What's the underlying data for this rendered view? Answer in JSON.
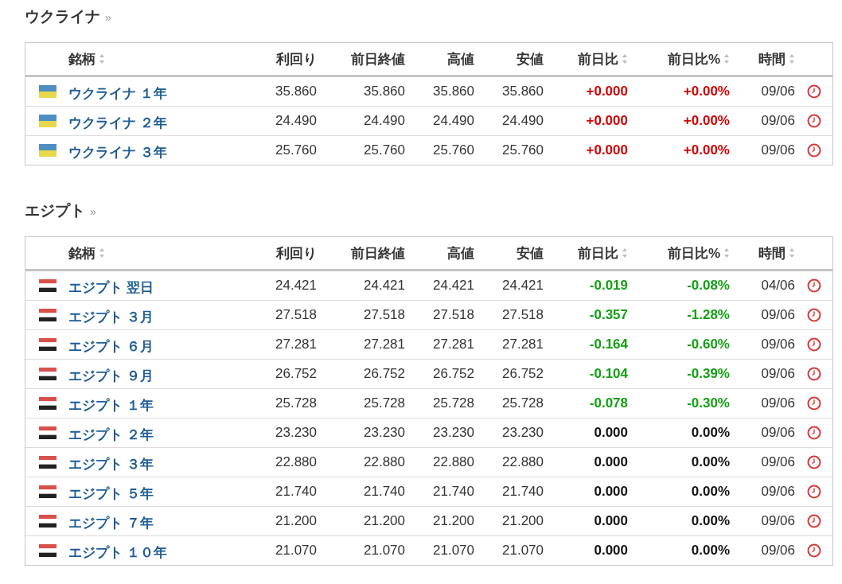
{
  "sections": [
    {
      "title": "ウクライナ",
      "more": "»",
      "columns": [
        {
          "label": "銘柄",
          "sortable": true
        },
        {
          "label": "利回り",
          "sortable": false
        },
        {
          "label": "前日終値",
          "sortable": false
        },
        {
          "label": "高値",
          "sortable": false
        },
        {
          "label": "安値",
          "sortable": false
        },
        {
          "label": "前日比",
          "sortable": true
        },
        {
          "label": "前日比%",
          "sortable": true
        },
        {
          "label": "時間",
          "sortable": true
        }
      ],
      "rows": [
        {
          "kind": "ukraine",
          "name": "ウクライナ １年",
          "yield": "35.860",
          "prev_close": "35.860",
          "high": "35.860",
          "low": "35.860",
          "color": "#d00000",
          "change": "+0.000",
          "change_pct": "+0.00%",
          "time": "09/06"
        },
        {
          "kind": "ukraine",
          "name": "ウクライナ ２年",
          "yield": "24.490",
          "prev_close": "24.490",
          "high": "24.490",
          "low": "24.490",
          "color": "#d00000",
          "change": "+0.000",
          "change_pct": "+0.00%",
          "time": "09/06"
        },
        {
          "kind": "ukraine",
          "name": "ウクライナ ３年",
          "yield": "25.760",
          "prev_close": "25.760",
          "high": "25.760",
          "low": "25.760",
          "color": "#d00000",
          "change": "+0.000",
          "change_pct": "+0.00%",
          "time": "09/06"
        }
      ]
    },
    {
      "title": "エジプト",
      "more": "»",
      "columns": [
        {
          "label": "銘柄",
          "sortable": true
        },
        {
          "label": "利回り",
          "sortable": false
        },
        {
          "label": "前日終値",
          "sortable": false
        },
        {
          "label": "高値",
          "sortable": false
        },
        {
          "label": "安値",
          "sortable": false
        },
        {
          "label": "前日比",
          "sortable": true
        },
        {
          "label": "前日比%",
          "sortable": true
        },
        {
          "label": "時間",
          "sortable": true
        }
      ],
      "rows": [
        {
          "kind": "egypt",
          "name": "エジプト 翌日",
          "yield": "24.421",
          "prev_close": "24.421",
          "high": "24.421",
          "low": "24.421",
          "color": "#12a012",
          "change": "-0.019",
          "change_pct": "-0.08%",
          "time": "04/06"
        },
        {
          "kind": "egypt",
          "name": "エジプト ３月",
          "yield": "27.518",
          "prev_close": "27.518",
          "high": "27.518",
          "low": "27.518",
          "color": "#12a012",
          "change": "-0.357",
          "change_pct": "-1.28%",
          "time": "09/06"
        },
        {
          "kind": "egypt",
          "name": "エジプト ６月",
          "yield": "27.281",
          "prev_close": "27.281",
          "high": "27.281",
          "low": "27.281",
          "color": "#12a012",
          "change": "-0.164",
          "change_pct": "-0.60%",
          "time": "09/06"
        },
        {
          "kind": "egypt",
          "name": "エジプト ９月",
          "yield": "26.752",
          "prev_close": "26.752",
          "high": "26.752",
          "low": "26.752",
          "color": "#12a012",
          "change": "-0.104",
          "change_pct": "-0.39%",
          "time": "09/06"
        },
        {
          "kind": "egypt",
          "name": "エジプト １年",
          "yield": "25.728",
          "prev_close": "25.728",
          "high": "25.728",
          "low": "25.728",
          "color": "#12a012",
          "change": "-0.078",
          "change_pct": "-0.30%",
          "time": "09/06"
        },
        {
          "kind": "egypt",
          "name": "エジプト ２年",
          "yield": "23.230",
          "prev_close": "23.230",
          "high": "23.230",
          "low": "23.230",
          "color": "#111111",
          "change": "0.000",
          "change_pct": "0.00%",
          "time": "09/06"
        },
        {
          "kind": "egypt",
          "name": "エジプト ３年",
          "yield": "22.880",
          "prev_close": "22.880",
          "high": "22.880",
          "low": "22.880",
          "color": "#111111",
          "change": "0.000",
          "change_pct": "0.00%",
          "time": "09/06"
        },
        {
          "kind": "egypt",
          "name": "エジプト ５年",
          "yield": "21.740",
          "prev_close": "21.740",
          "high": "21.740",
          "low": "21.740",
          "color": "#111111",
          "change": "0.000",
          "change_pct": "0.00%",
          "time": "09/06"
        },
        {
          "kind": "egypt",
          "name": "エジプト ７年",
          "yield": "21.200",
          "prev_close": "21.200",
          "high": "21.200",
          "low": "21.200",
          "color": "#111111",
          "change": "0.000",
          "change_pct": "0.00%",
          "time": "09/06"
        },
        {
          "kind": "egypt",
          "name": "エジプト １０年",
          "yield": "21.070",
          "prev_close": "21.070",
          "high": "21.070",
          "low": "21.070",
          "color": "#111111",
          "change": "0.000",
          "change_pct": "0.00%",
          "time": "09/06"
        }
      ]
    }
  ]
}
